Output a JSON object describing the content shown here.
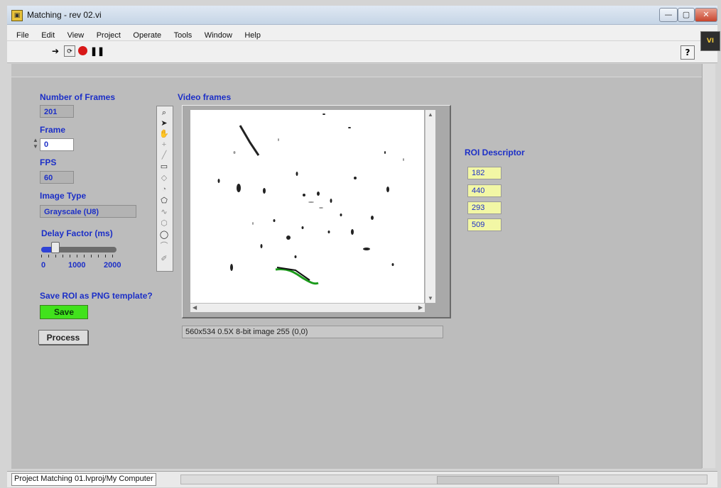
{
  "window": {
    "title": "Matching - rev 02.vi",
    "controls": [
      "—",
      "▢",
      "✕"
    ]
  },
  "menu": [
    "File",
    "Edit",
    "View",
    "Project",
    "Operate",
    "Tools",
    "Window",
    "Help"
  ],
  "toolbar": {
    "help_icon": "?"
  },
  "panel": {
    "num_frames": {
      "label": "Number of Frames",
      "value": "201"
    },
    "frame": {
      "label": "Frame",
      "value": "0"
    },
    "fps": {
      "label": "FPS",
      "value": "60"
    },
    "image_type": {
      "label": "Image Type",
      "value": "Grayscale (U8)"
    },
    "delay": {
      "label": "Delay Factor (ms)",
      "ticks": [
        "0",
        "1000",
        "2000"
      ],
      "level": 0.18
    },
    "save_roi": {
      "label": "Save ROI as PNG template?",
      "button": "Save"
    },
    "process_button": "Process",
    "video": {
      "label": "Video frames",
      "status": "560x534 0.5X 8-bit image 255    (0,0)"
    },
    "roi": {
      "label": "ROI Descriptor",
      "values": [
        "182",
        "440",
        "293",
        "509"
      ]
    }
  },
  "statusbar": {
    "project": "Project Matching 01.lvproj/My Computer"
  },
  "colors": {
    "label_blue": "#1c2fc7",
    "save_green": "#41e21c",
    "roi_yellow": "#f2f7a5",
    "panel_gray": "#bcbcbc"
  }
}
